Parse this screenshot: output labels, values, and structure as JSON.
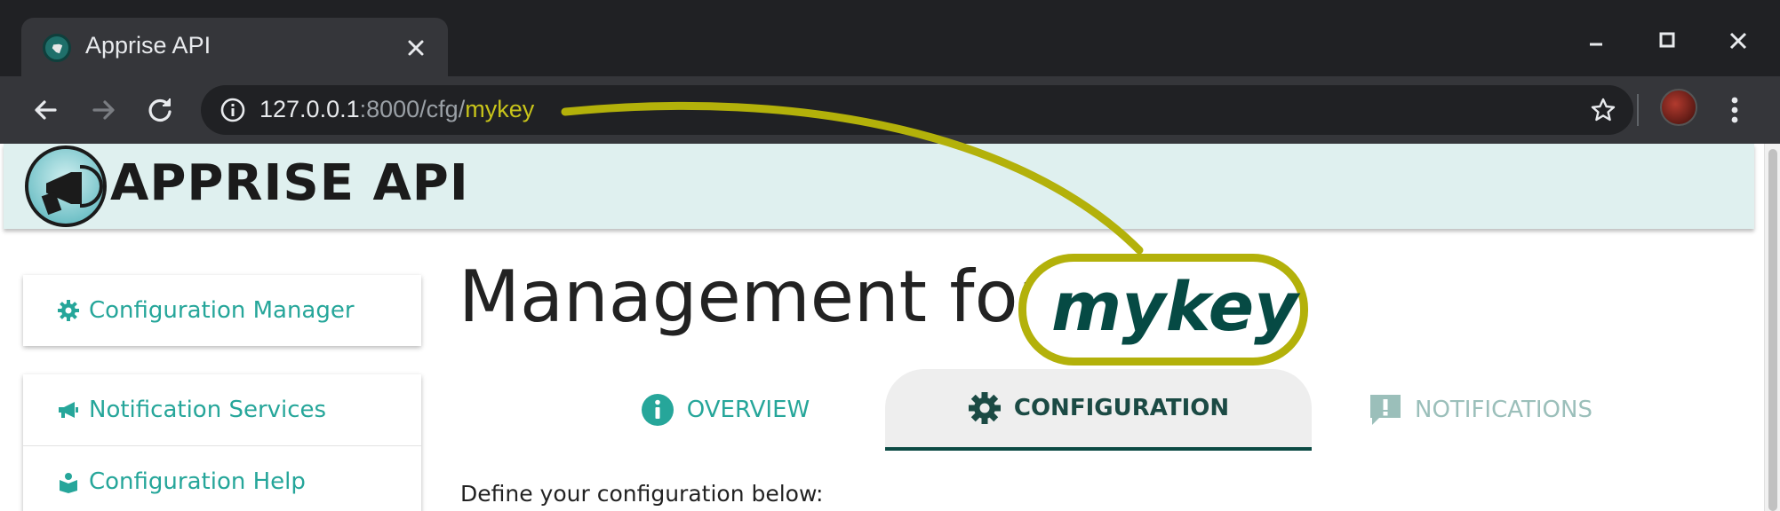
{
  "browser": {
    "tab_title": "Apprise API",
    "url": {
      "host": "127.0.0.1",
      "path": ":8000/cfg/",
      "key": "mykey"
    }
  },
  "app": {
    "title": "APPRISE API"
  },
  "sidebar": {
    "items": [
      {
        "label": "Configuration Manager",
        "icon": "gear-icon"
      },
      {
        "label": "Notification Services",
        "icon": "megaphone-icon"
      },
      {
        "label": "Configuration Help",
        "icon": "book-icon"
      }
    ]
  },
  "main": {
    "title_prefix": "Management for:",
    "key": "mykey",
    "tabs": [
      {
        "label": "OVERVIEW",
        "icon": "info-icon",
        "state": "inactive"
      },
      {
        "label": "CONFIGURATION",
        "icon": "gear-icon",
        "state": "active"
      },
      {
        "label": "NOTIFICATIONS",
        "icon": "alert-comment-icon",
        "state": "disabled"
      }
    ],
    "instruction": "Define your configuration below:"
  },
  "colors": {
    "accent_teal": "#26a69a",
    "dark_teal": "#064a44",
    "highlight_olive": "#b3b10a",
    "header_bg": "#dff0ef"
  }
}
